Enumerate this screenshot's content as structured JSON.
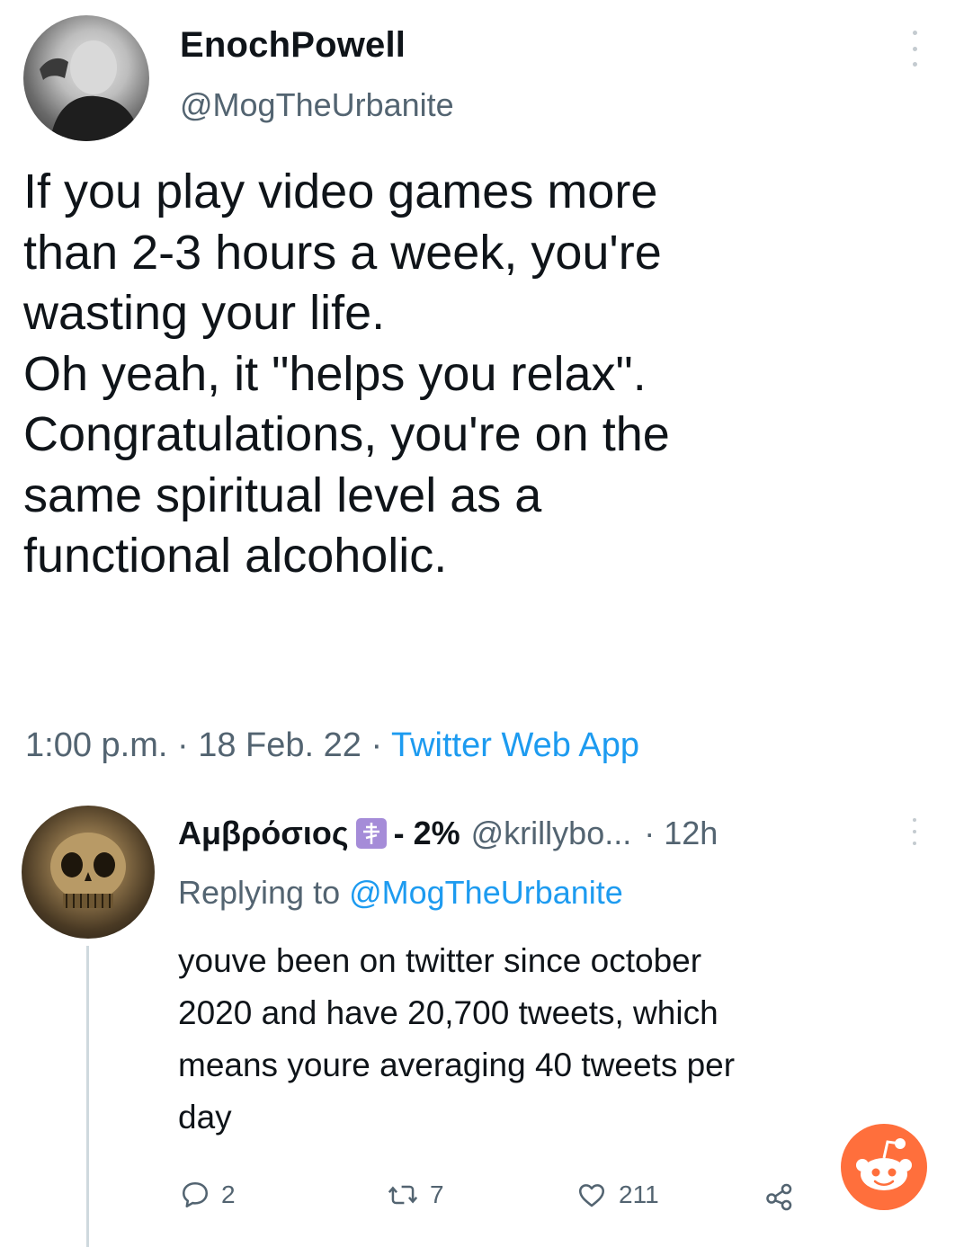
{
  "main_tweet": {
    "author_name": "EnochPowell",
    "author_handle": "@MogTheUrbanite",
    "text": "If you play video games more\nthan 2-3 hours a week, you're\nwasting your life.\nOh yeah, it \"helps you relax\".\nCongratulations, you're on the\nsame spiritual level as a\nfunctional alcoholic.",
    "time": "1:00 p.m.",
    "date": "18 Feb. 22",
    "source": "Twitter Web App",
    "separator": " · "
  },
  "reply": {
    "author_name": "Αμβρόσιος",
    "name_suffix": "- 2%",
    "author_handle": "@krillybo...",
    "time_separator": "·",
    "time": "12h",
    "replying_prefix": "Replying to ",
    "replying_to": "@MogTheUrbanite",
    "text": "youve been on twitter since october\n2020 and have 20,700 tweets, which\nmeans youre averaging 40 tweets per\nday",
    "actions": {
      "reply_count": "2",
      "retweet_count": "7",
      "like_count": "211"
    }
  },
  "icons": {
    "more": "more-vertical-icon",
    "reply": "comment-icon",
    "retweet": "retweet-icon",
    "like": "heart-icon",
    "share": "share-icon",
    "badge": "orthodox-cross-icon",
    "watermark": "reddit-icon"
  },
  "colors": {
    "text": "#0f1419",
    "secondary": "#536471",
    "link": "#1d9bf0",
    "badge": "#a58cd8",
    "reddit": "#ff6f3c"
  }
}
